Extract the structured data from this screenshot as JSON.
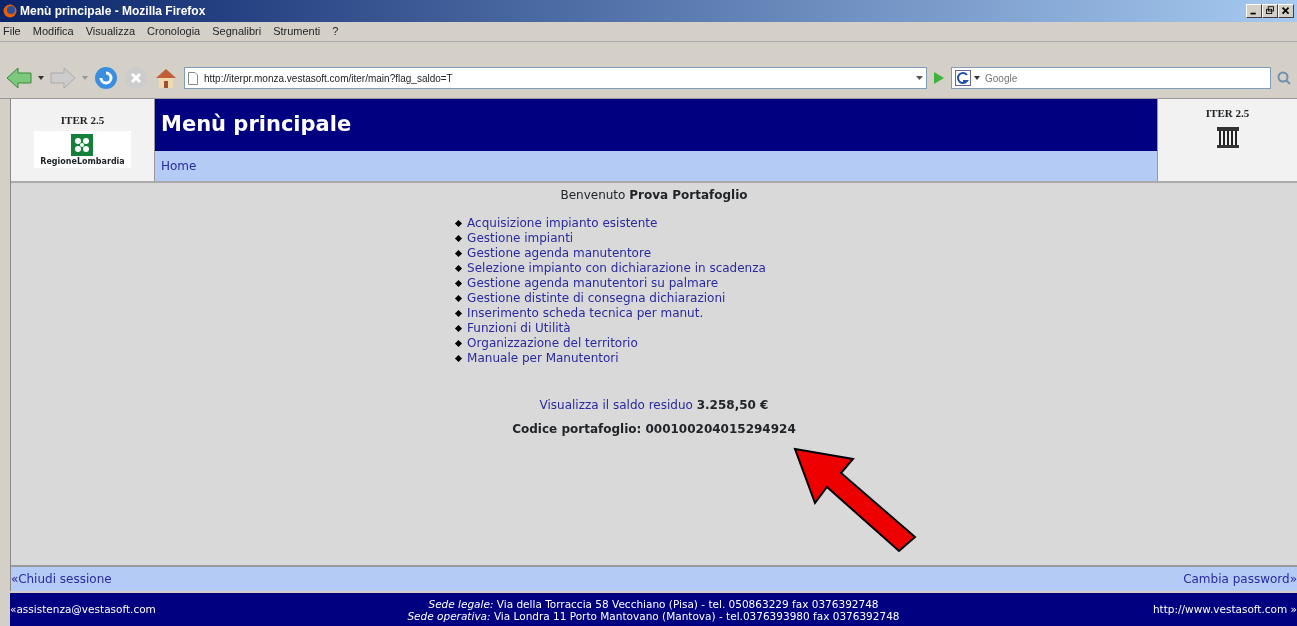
{
  "window": {
    "title": "Menù principale - Mozilla Firefox"
  },
  "menu_bar": [
    "File",
    "Modifica",
    "Visualizza",
    "Cronologia",
    "Segnalibri",
    "Strumenti",
    "?"
  ],
  "address_bar": {
    "value": "http://iterpr.monza.vestasoft.com/iter/main?flag_saldo=T"
  },
  "search": {
    "placeholder": "Google"
  },
  "header": {
    "left_version": "ITER 2.5",
    "logo_text": "RegioneLombardia",
    "title": "Menù principale",
    "breadcrumb": "Home",
    "right_version": "ITER 2.5"
  },
  "content": {
    "welcome_label": "Benvenuto",
    "welcome_name": "Prova Portafoglio",
    "menu_items": [
      "Acquisizione impianto esistente",
      "Gestione impianti",
      "Gestione agenda manutentore",
      "Selezione impianto con dichiarazione in scadenza",
      "Gestione agenda manutentori su palmare",
      "Gestione distinte di consegna dichiarazioni",
      "Inserimento scheda tecnica per manut.",
      "Funzioni di Utilità",
      "Organizzazione del territorio",
      "Manuale per Manutentori"
    ],
    "balance_link": "Visualizza il saldo residuo",
    "balance_value": "3.258,50 €",
    "wallet_code": "Codice portafoglio: 000100204015294924"
  },
  "bottom_bar": {
    "left": "«Chiudi sessione",
    "right": "Cambia password»"
  },
  "footer": {
    "email": "«assistenza@vestasoft.com",
    "lines": [
      "*Sede legale:* Via della Torraccia 58 Vecchiano (Pisa) - tel. 050863229 fax 0376392748",
      "*Sede operativa:* Via Londra 11 Porto Mantovano (Mantova) - tel.0376393980 fax 0376392748"
    ],
    "website": "http://www.vestasoft.com »"
  }
}
